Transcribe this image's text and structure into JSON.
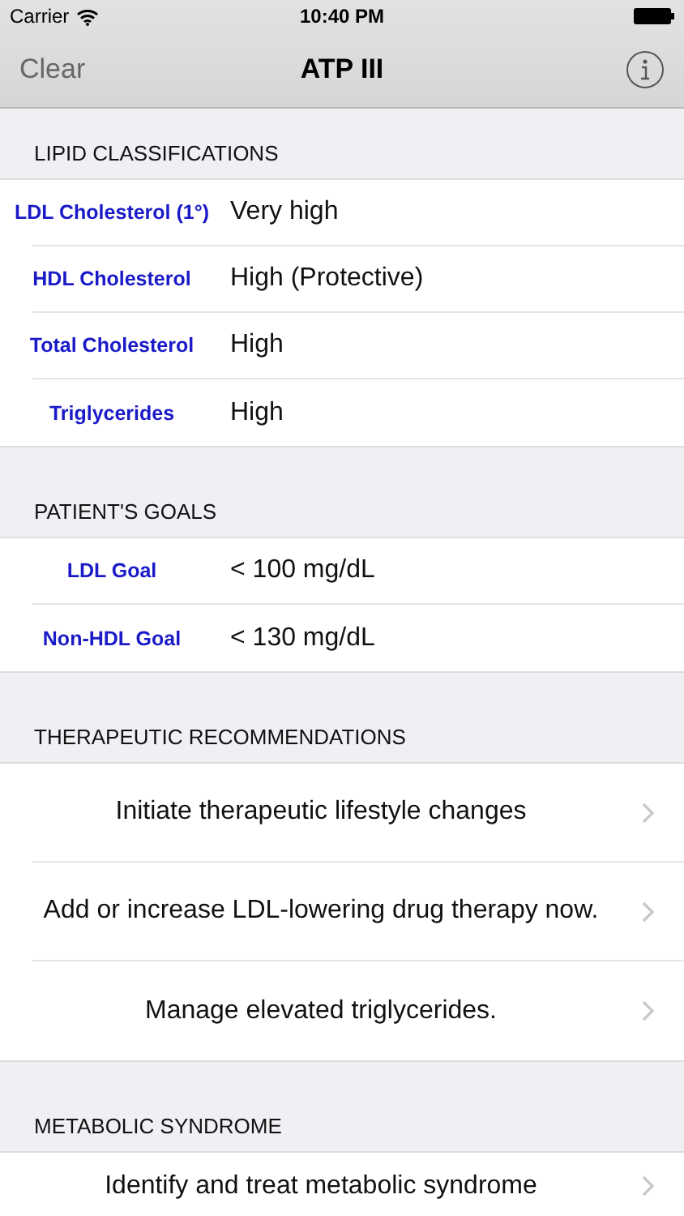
{
  "status_bar": {
    "carrier": "Carrier",
    "time": "10:40 PM"
  },
  "nav_bar": {
    "left_button": "Clear",
    "title": "ATP III"
  },
  "sections": [
    {
      "header": "LIPID CLASSIFICATIONS",
      "kind": "detail",
      "rows": [
        {
          "label": "LDL Cholesterol (1°)",
          "value": "Very high"
        },
        {
          "label": "HDL Cholesterol",
          "value": "High (Protective)"
        },
        {
          "label": "Total Cholesterol",
          "value": "High"
        },
        {
          "label": "Triglycerides",
          "value": "High"
        }
      ]
    },
    {
      "header": "PATIENT'S GOALS",
      "kind": "detail",
      "rows": [
        {
          "label": "LDL Goal",
          "value": "< 100 mg/dL"
        },
        {
          "label": "Non-HDL Goal",
          "value": "< 130 mg/dL"
        }
      ]
    },
    {
      "header": "THERAPEUTIC RECOMMENDATIONS",
      "kind": "action",
      "rows": [
        {
          "text": "Initiate therapeutic lifestyle changes"
        },
        {
          "text": "Add or increase LDL-lowering drug therapy now."
        },
        {
          "text": "Manage elevated triglycerides."
        }
      ]
    },
    {
      "header": "METABOLIC SYNDROME",
      "kind": "action",
      "rows": [
        {
          "text": "Identify and treat metabolic syndrome"
        }
      ]
    }
  ]
}
